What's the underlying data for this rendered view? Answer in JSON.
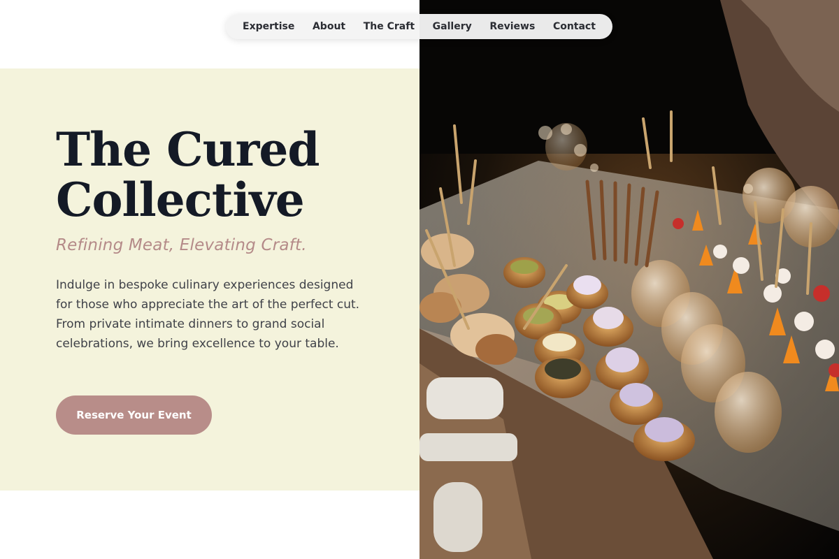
{
  "nav": {
    "items": [
      {
        "label": "Expertise"
      },
      {
        "label": "About"
      },
      {
        "label": "The Craft"
      },
      {
        "label": "Gallery"
      },
      {
        "label": "Reviews"
      },
      {
        "label": "Contact"
      }
    ]
  },
  "hero": {
    "title_line1": "The Cured",
    "title_line2": "Collective",
    "tagline": "Refining Meat, Elevating Craft.",
    "body": "Indulge in bespoke culinary experiences designed for those who appreciate the art of the perfect cut. From private intimate dinners to grand social celebrations, we bring excellence to your table.",
    "cta_label": "Reserve Your Event"
  },
  "colors": {
    "panel_background": "#f4f3dc",
    "title": "#141a26",
    "tagline": "#b48a88",
    "body_text": "#3f4148",
    "cta_background": "#b88d89"
  }
}
